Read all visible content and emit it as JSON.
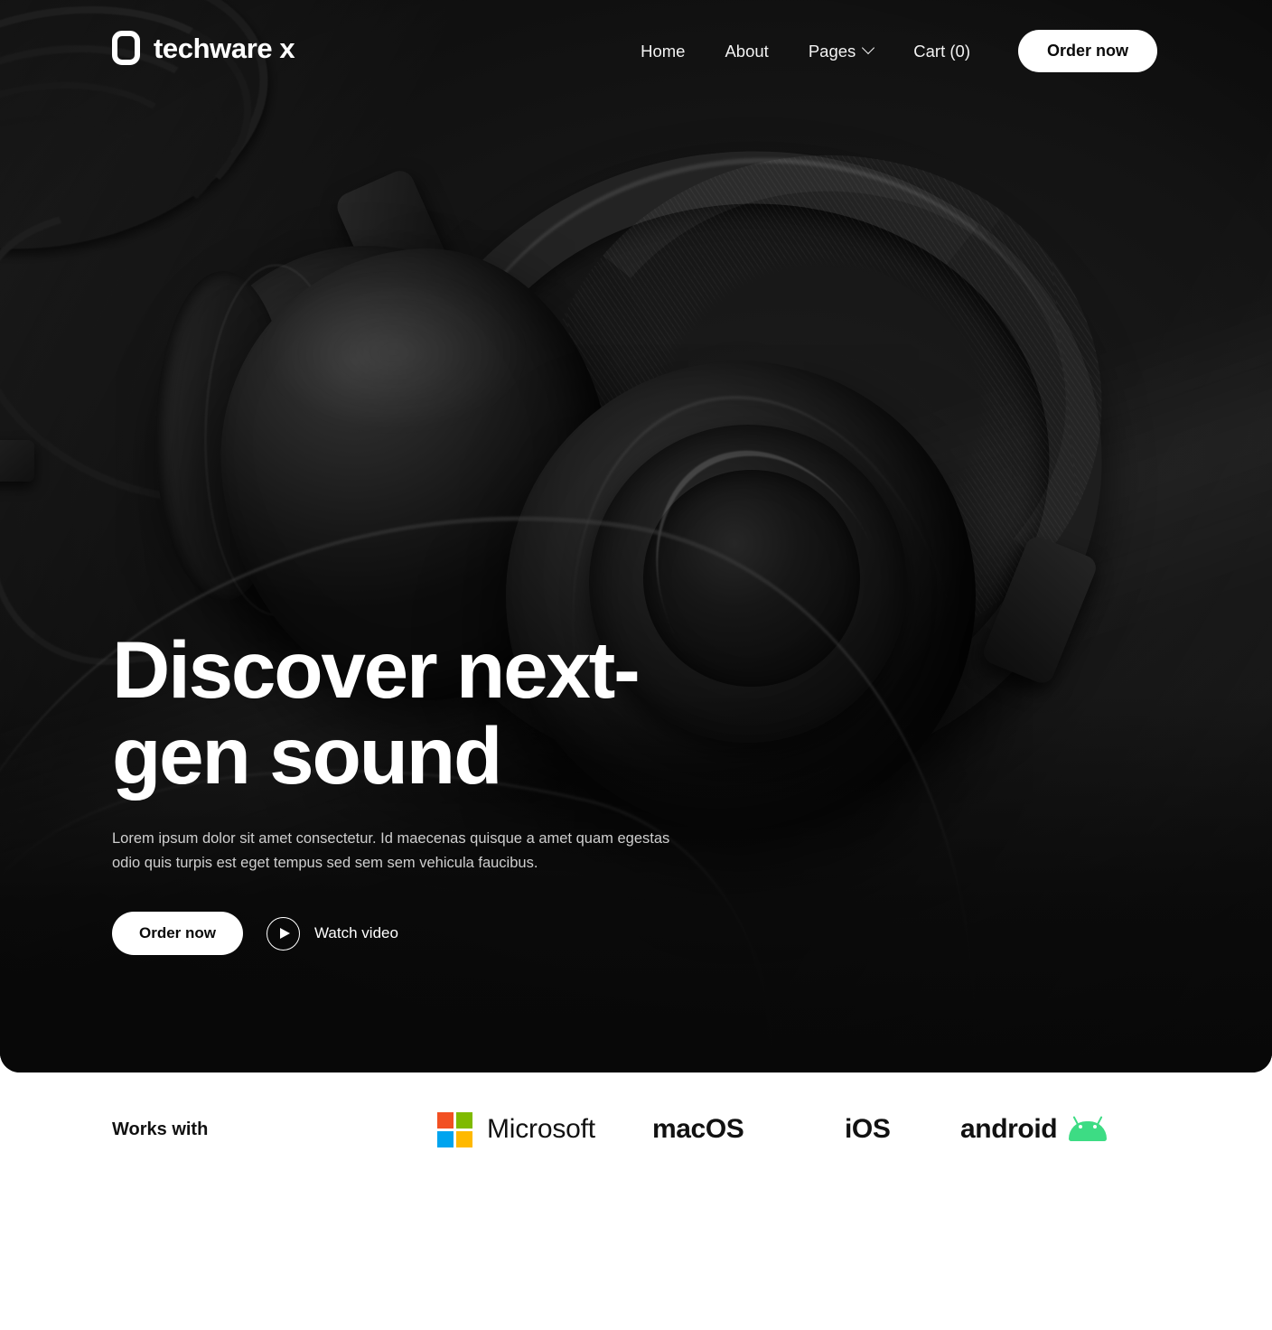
{
  "brand": {
    "name": "techware x",
    "mark_icon": "rounded-square-logo-icon"
  },
  "header": {
    "nav": [
      {
        "label": "Home"
      },
      {
        "label": "About"
      },
      {
        "label": "Pages",
        "icon": "chevron-down-icon"
      },
      {
        "label": "Cart (0)"
      }
    ],
    "cta_label": "Order now"
  },
  "hero": {
    "title_line1": "Discover next-",
    "title_line2": "gen sound",
    "subtitle_line1": "Lorem ipsum dolor sit amet consectetur. Id maecenas quisque a amet quam",
    "subtitle_line2": "egestas odio quis turpis est eget tempus sed sem sem vehicula faucibus.",
    "primary_cta": "Order now",
    "secondary_cta": "Watch  video",
    "play_icon": "play-circle-icon"
  },
  "works_with": {
    "label": "Works with",
    "logos": [
      {
        "name": "Microsoft",
        "icon": "microsoft-squares-icon"
      },
      {
        "name": "macOS",
        "icon": ""
      },
      {
        "name": "iOS",
        "icon": ""
      },
      {
        "name": "android",
        "icon": "android-robot-icon"
      }
    ]
  },
  "colors": {
    "hero_background": "#0a0a0a",
    "strip_background": "#ffffff",
    "accent_white": "#ffffff",
    "text_muted": "#cfcfcf",
    "ms_red": "#f25022",
    "ms_green": "#7fba00",
    "ms_blue": "#00a4ef",
    "ms_yellow": "#ffb900",
    "android_green": "#3ddc84"
  }
}
